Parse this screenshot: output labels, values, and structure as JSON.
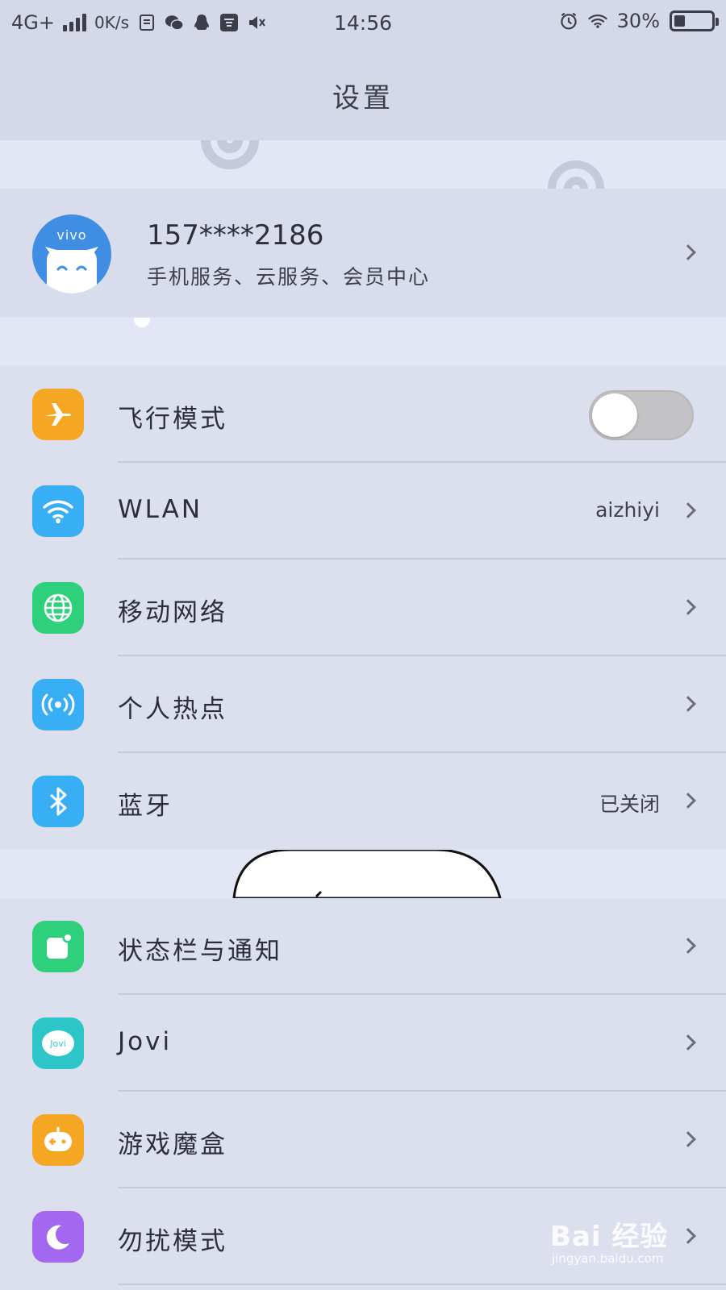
{
  "status_bar": {
    "network": "4G+",
    "speed": "0K/s",
    "time": "14:56",
    "battery": "30%",
    "battery_level": 0.3,
    "icons": [
      "signal-icon",
      "sim-icon",
      "wechat-icon",
      "qq-icon",
      "taobao-icon",
      "mute-icon",
      "alarm-icon",
      "wifi-icon",
      "battery-icon"
    ]
  },
  "header": {
    "title": "设置"
  },
  "account": {
    "avatar_brand": "vivo",
    "phone": "157****2186",
    "subtitle": "手机服务、云服务、会员中心"
  },
  "group1": [
    {
      "label": "飞行模式",
      "icon": "airplane-icon",
      "color": "#f5a623",
      "toggle": false
    },
    {
      "label": "WLAN",
      "value": "aizhiyi",
      "icon": "wifi-icon",
      "color": "#38aef5"
    },
    {
      "label": "移动网络",
      "icon": "globe-icon",
      "color": "#2fd07b"
    },
    {
      "label": "个人热点",
      "icon": "hotspot-icon",
      "color": "#38aef5"
    },
    {
      "label": "蓝牙",
      "value": "已关闭",
      "icon": "bluetooth-icon",
      "color": "#38aef5"
    }
  ],
  "group2": [
    {
      "label": "状态栏与通知",
      "icon": "notification-icon",
      "color": "#2fd07b"
    },
    {
      "label": "Jovi",
      "icon": "jovi-icon",
      "color": "#2cc6c9",
      "icon_text": "Jovi"
    },
    {
      "label": "游戏魔盒",
      "icon": "gamepad-icon",
      "color": "#f5a623"
    },
    {
      "label": "勿扰模式",
      "icon": "moon-icon",
      "color": "#a367f0"
    }
  ],
  "watermark": {
    "main": "Bai 经验",
    "sub": "jingyan.baidu.com"
  }
}
